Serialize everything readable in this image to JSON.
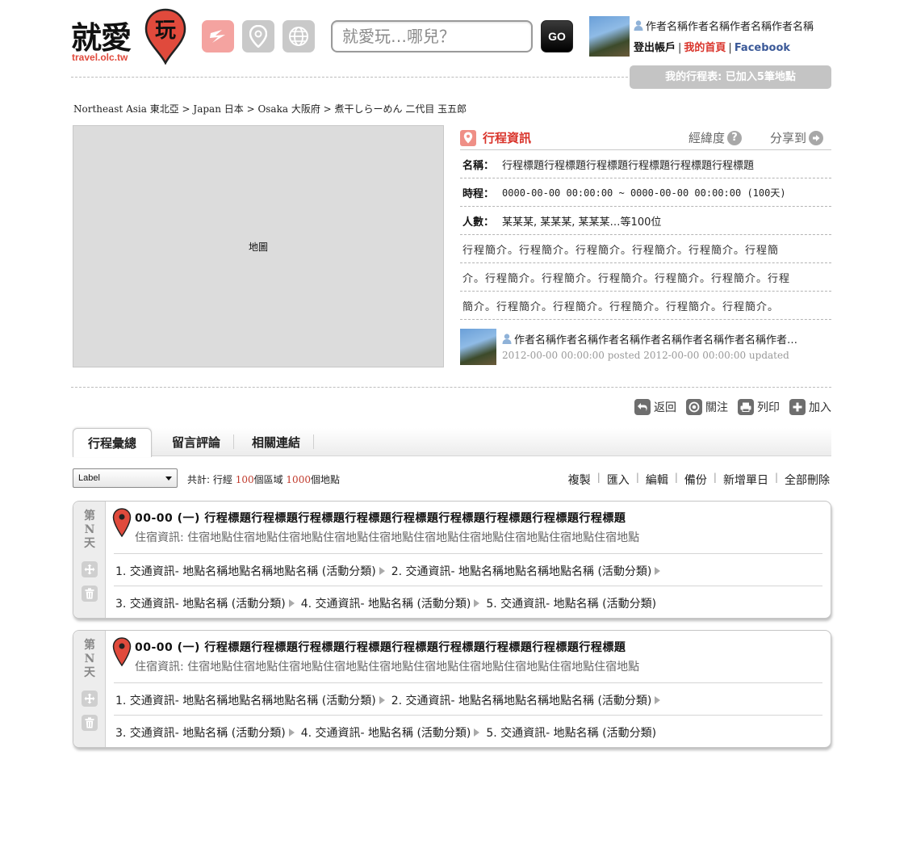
{
  "header": {
    "logo_text": "就愛",
    "logo_pin_char": "玩",
    "logo_url": "travel.olc.tw",
    "category_icons": [
      "flash-icon",
      "map-pin-icon",
      "globe-icon"
    ],
    "search": {
      "placeholder": "就愛玩…哪兒？",
      "go_label": "GO"
    },
    "user": {
      "name": "作者名稱作者名稱作者名稱作者名稱",
      "logout": "登出帳戶",
      "home": "我的首頁",
      "facebook": "Facebook"
    },
    "trip_button": "我的行程表: 已加入5筆地點"
  },
  "breadcrumb": {
    "items": [
      "Northeast Asia 東北亞",
      "Japan 日本",
      "Osaka 大阪府",
      "煮干しらーめん 二代目 玉五郎"
    ],
    "separator": " > "
  },
  "map": {
    "placeholder": "地圖"
  },
  "info": {
    "title": "行程資訊",
    "latlng": "經緯度",
    "share": "分享到",
    "name_label": "名稱：",
    "name_value": "行程標題行程標題行程標題行程標題行程標題行程標題",
    "time_label": "時程：",
    "time_value": "0000-00-00 00:00:00 ~ 0000-00-00 00:00:00 (100天)",
    "people_label": "人數：",
    "people_value": "某某某, 某某某, 某某某…等100位",
    "desc_lines": [
      "行程簡介。行程簡介。行程簡介。行程簡介。行程簡介。行程簡",
      "介。行程簡介。行程簡介。行程簡介。行程簡介。行程簡介。行程",
      "簡介。行程簡介。行程簡介。行程簡介。行程簡介。行程簡介。"
    ],
    "author_name": "作者名稱作者名稱作者名稱作者名稱作者名稱作者名稱作者…",
    "author_date": "2012-00-00 00:00:00 posted  2012-00-00 00:00:00 updated"
  },
  "actions": [
    "返回",
    "關注",
    "列印",
    "加入"
  ],
  "tabs": [
    "行程彙總",
    "留言評論",
    "相關連結"
  ],
  "toolbar": {
    "select_value": "Label",
    "count_prefix": "共計: 行經 ",
    "area_count": "100",
    "area_suffix": "個區域 ",
    "place_count": "1000",
    "place_suffix": "個地點",
    "ops": [
      "複製",
      "匯入",
      "編輯",
      "備份",
      "新增單日",
      "全部刪除"
    ]
  },
  "days": [
    {
      "day_label": [
        "第",
        "N",
        "天"
      ],
      "title": "00-00 (一) 行程標題行程標題行程標題行程標題行程標題行程標題行程標題行程標題行程標題",
      "stay": "住宿資訊: 住宿地點住宿地點住宿地點住宿地點住宿地點住宿地點住宿地點住宿地點住宿地點住宿地點",
      "route_line1": [
        "1. 交通資訊- 地點名稱地點名稱地點名稱 (活動分類)",
        "2. 交通資訊- 地點名稱地點名稱地點名稱 (活動分類)"
      ],
      "route_line2": [
        "3. 交通資訊- 地點名稱 (活動分類)",
        "4. 交通資訊- 地點名稱 (活動分類)",
        "5. 交通資訊- 地點名稱 (活動分類)"
      ]
    },
    {
      "day_label": [
        "第",
        "N",
        "天"
      ],
      "title": "00-00 (一) 行程標題行程標題行程標題行程標題行程標題行程標題行程標題行程標題行程標題",
      "stay": "住宿資訊: 住宿地點住宿地點住宿地點住宿地點住宿地點住宿地點住宿地點住宿地點住宿地點住宿地點",
      "route_line1": [
        "1. 交通資訊- 地點名稱地點名稱地點名稱 (活動分類)",
        "2. 交通資訊- 地點名稱地點名稱地點名稱 (活動分類)"
      ],
      "route_line2": [
        "3. 交通資訊- 地點名稱 (活動分類)",
        "4. 交通資訊- 地點名稱 (活動分類)",
        "5. 交通資訊- 地點名稱 (活動分類)"
      ]
    }
  ],
  "colors": {
    "brand_red": "#d9342b",
    "pin_red": "#e04a3c",
    "facebook_blue": "#3b5998",
    "count_red": "#c0392b"
  }
}
